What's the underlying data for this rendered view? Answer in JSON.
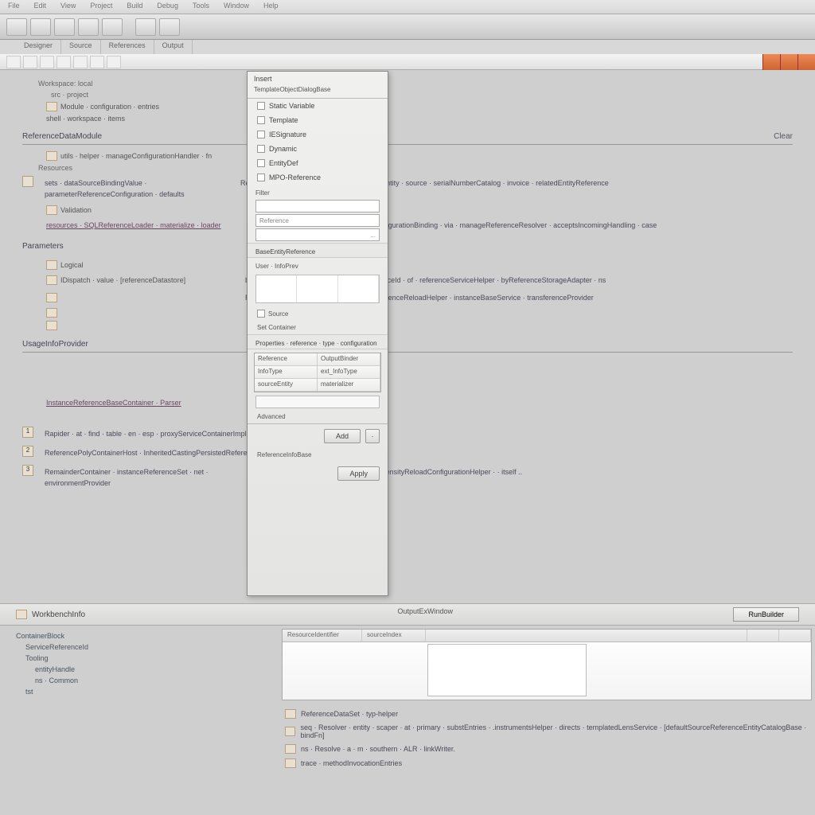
{
  "menubar": [
    "File",
    "Edit",
    "View",
    "Project",
    "Build",
    "Debug",
    "Tools",
    "Window",
    "Help"
  ],
  "tabs": [
    "Designer",
    "Source",
    "References",
    "Output"
  ],
  "close_btn": "×",
  "content": {
    "top_tree": {
      "header": "Workspace: local",
      "sub": "src · project",
      "items": [
        "Module · configuration · entries",
        "shell · workspace · items"
      ]
    },
    "section1": {
      "title": "ReferenceDataModule",
      "clear": "Clear",
      "row": "utils · helper · manageConfigurationHandler · fn",
      "subhdr": "Resources",
      "desc1": "sets · dataSourceBindingValue · parameterReferenceConfiguration · defaults",
      "desc1b": "ReferenceDataAdapter · returnsDataBindingEntity · source · serialNumberCatalog · invoice · relatedEntityReference",
      "it1": "Validation",
      "link": "resources · SQLReferenceLoader · materialize · loader",
      "link_b": "ReferenceServiceConnector · followersConfigurationBinding · via · manageReferenceResolver · acceptsIncomingHandling · case"
    },
    "section2": {
      "title": "Parameters",
      "it": "Logical",
      "row": "IDispatch · value · [referenceDatastore]",
      "row_b": "bindConfigurationParameter · ns · itemsSourceId · of · referenceServiceHelper · byReferenceStorageAdapter · ns",
      "desc": "ReferencedDataContingentSet · engineReferenceReloadHelper · instanceBaseService · transferenceProvider"
    },
    "section3": {
      "title": "UsageInfoProvider"
    },
    "section4": {
      "link": "InstanceReferenceBaseContainer · Parser",
      "n1": "1",
      "n2": "2",
      "n3": "3",
      "l1": "Rapider · at · find · table · en · esp · proxyServiceContainerImpl · versionHelper",
      "l2": "ReferencePolyContainerHost · InheritedCastingPersistedReferenceHost · reservedDict",
      "l3": "RemainderContainer · instanceReferenceSet · net · environmentProvider",
      "l3b": "transferCachingMemoryReference · let · intensityReloadConfigurationHelper · · itself .."
    }
  },
  "dialog": {
    "title": "Insert",
    "subtitle": "TemplateObjectDialogBase",
    "opts": [
      "Static Variable",
      "Template",
      "IESignature",
      "Dynamic",
      "EntityDef",
      "MPO-Reference"
    ],
    "filter_label": "Filter",
    "filter_value": "",
    "field1_value": "Reference",
    "ellipsis": "...",
    "section1": "BaseEntityReference",
    "preview_label": "User · InfoPrev",
    "source_opt": "Source",
    "container_opt": "Set Container",
    "table_section": "Properties · reference · type · configuration",
    "rows": [
      [
        "Reference",
        "OutputBinder"
      ],
      [
        "InfoType",
        "ext_InfoType"
      ],
      [
        "sourceEntity",
        "materializer"
      ]
    ],
    "advanced": "Advanced",
    "ok": "Add",
    "small_btn": "·",
    "status": "ReferenceInfoBase",
    "footer_btn": "Apply"
  },
  "bottom": {
    "left_hdr": "WorkbenchInfo",
    "center_hdr": "OutputExWindow",
    "btn": "RunBuilder",
    "tree": [
      "ContainerBlock",
      "ServiceReferenceId",
      "Tooling",
      "entityHandle",
      "ns · Common",
      "tst"
    ],
    "table_headers": [
      "ResourceIdentifier",
      "sourceIndex",
      "",
      "",
      ""
    ],
    "lines": [
      "ReferenceDataSet · typ-helper",
      "seq · Resolver · entity · scaper · at · primary · substEntries · .instrumentsHelper · directs · templatedLensService · [defaultSourceReferenceEntityCatalogBase · bindFn]",
      "ns · Resolve · a · m · southern · ALR · linkWriter.",
      "trace · methodInvocationEntries"
    ]
  }
}
